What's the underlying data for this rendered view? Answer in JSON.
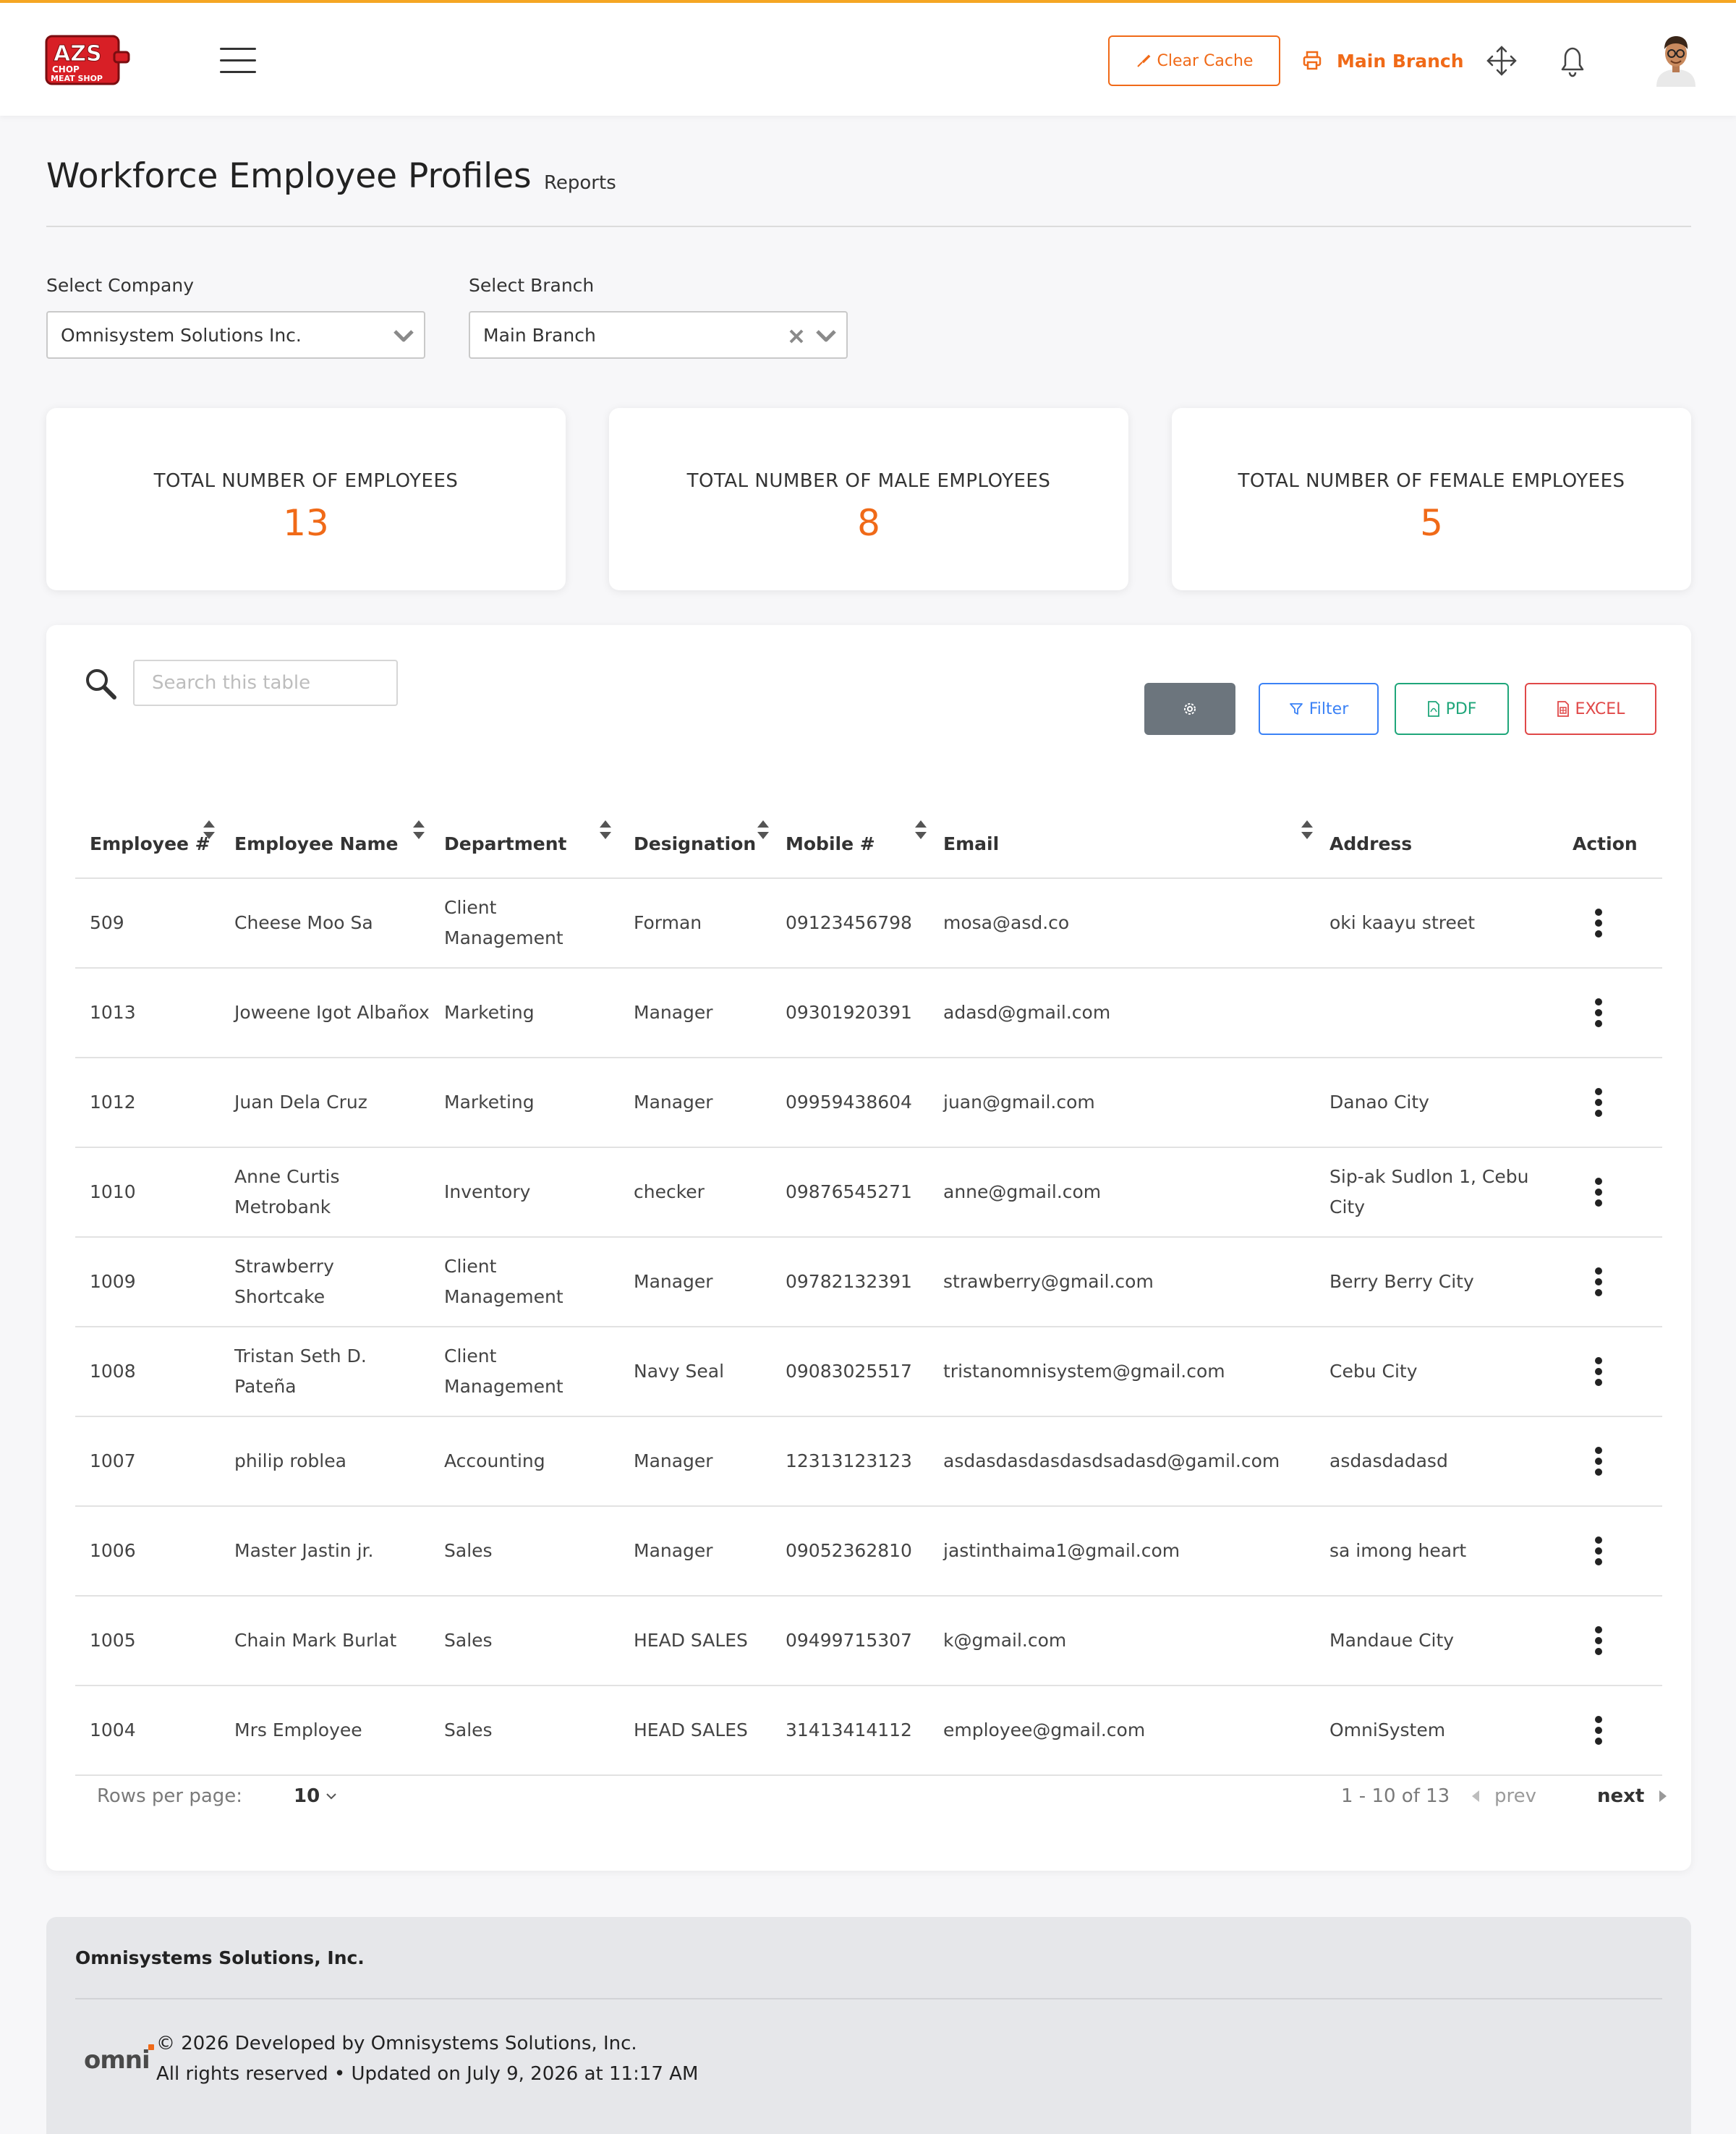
{
  "header": {
    "clear_cache_label": "Clear Cache",
    "branch_label": "Main Branch"
  },
  "page": {
    "title": "Workforce Employee Profiles",
    "subtitle": "Reports"
  },
  "filters": {
    "company_label": "Select Company",
    "company_value": "Omnisystem Solutions Inc.",
    "branch_label": "Select Branch",
    "branch_value": "Main Branch"
  },
  "stats": [
    {
      "label": "TOTAL NUMBER OF EMPLOYEES",
      "value": "13"
    },
    {
      "label": "TOTAL NUMBER OF MALE EMPLOYEES",
      "value": "8"
    },
    {
      "label": "TOTAL NUMBER OF FEMALE EMPLOYEES",
      "value": "5"
    }
  ],
  "table": {
    "search_placeholder": "Search this table",
    "filter_label": "Filter",
    "pdf_label": "PDF",
    "excel_label": "EXCEL",
    "columns": [
      "Employee #",
      "Employee Name",
      "Department",
      "Designation",
      "Mobile #",
      "Email",
      "Address",
      "Action"
    ],
    "rows": [
      {
        "id": "509",
        "name": "Cheese Moo Sa",
        "department": "Client Management",
        "designation": "Forman",
        "mobile": "09123456798",
        "email": "mosa@asd.co",
        "address": "oki kaayu street"
      },
      {
        "id": "1013",
        "name": "Joweene Igot Albañox",
        "department": "Marketing",
        "designation": "Manager",
        "mobile": "09301920391",
        "email": "adasd@gmail.com",
        "address": ""
      },
      {
        "id": "1012",
        "name": "Juan Dela Cruz",
        "department": "Marketing",
        "designation": "Manager",
        "mobile": "09959438604",
        "email": "juan@gmail.com",
        "address": "Danao City"
      },
      {
        "id": "1010",
        "name": "Anne Curtis Metrobank",
        "department": "Inventory",
        "designation": "checker",
        "mobile": "09876545271",
        "email": "anne@gmail.com",
        "address": "Sip-ak Sudlon 1, Cebu City"
      },
      {
        "id": "1009",
        "name": "Strawberry Shortcake",
        "department": "Client Management",
        "designation": "Manager",
        "mobile": "09782132391",
        "email": "strawberry@gmail.com",
        "address": "Berry Berry City"
      },
      {
        "id": "1008",
        "name": "Tristan Seth D. Pateña",
        "department": "Client Management",
        "designation": "Navy Seal",
        "mobile": "09083025517",
        "email": "tristanomnisystem@gmail.com",
        "address": "Cebu City"
      },
      {
        "id": "1007",
        "name": "philip roblea",
        "department": "Accounting",
        "designation": "Manager",
        "mobile": "12313123123",
        "email": "asdasdasdasdasdsadasd@gamil.com",
        "address": "asdasdadasd"
      },
      {
        "id": "1006",
        "name": "Master Jastin jr.",
        "department": "Sales",
        "designation": "Manager",
        "mobile": "09052362810",
        "email": "jastinthaima1@gmail.com",
        "address": "sa imong heart"
      },
      {
        "id": "1005",
        "name": "Chain Mark Burlat",
        "department": "Sales",
        "designation": "HEAD SALES",
        "mobile": "09499715307",
        "email": "k@gmail.com",
        "address": "Mandaue City"
      },
      {
        "id": "1004",
        "name": "Mrs Employee",
        "department": "Sales",
        "designation": "HEAD SALES",
        "mobile": "31413414112",
        "email": "employee@gmail.com",
        "address": "OmniSystem"
      }
    ]
  },
  "pagination": {
    "rows_per_page_label": "Rows per page:",
    "rows_per_page_value": "10",
    "range": "1 - 10 of 13",
    "prev_label": "prev",
    "next_label": "next"
  },
  "footer": {
    "company": "Omnisystems Solutions, Inc.",
    "logo_text": "omni",
    "line1": "© 2026 Developed by Omnisystems Solutions, Inc.",
    "line2": "All rights reserved • Updated on July 9, 2026 at 11:17 AM"
  },
  "logo_text": "AZS CHOP MEAT SHOP",
  "colors": {
    "accent": "#f06a18",
    "top_border": "#f5a623",
    "filter": "#3b82f6",
    "pdf": "#1fa67a",
    "excel": "#e04848",
    "gear_button": "#6c757d"
  }
}
